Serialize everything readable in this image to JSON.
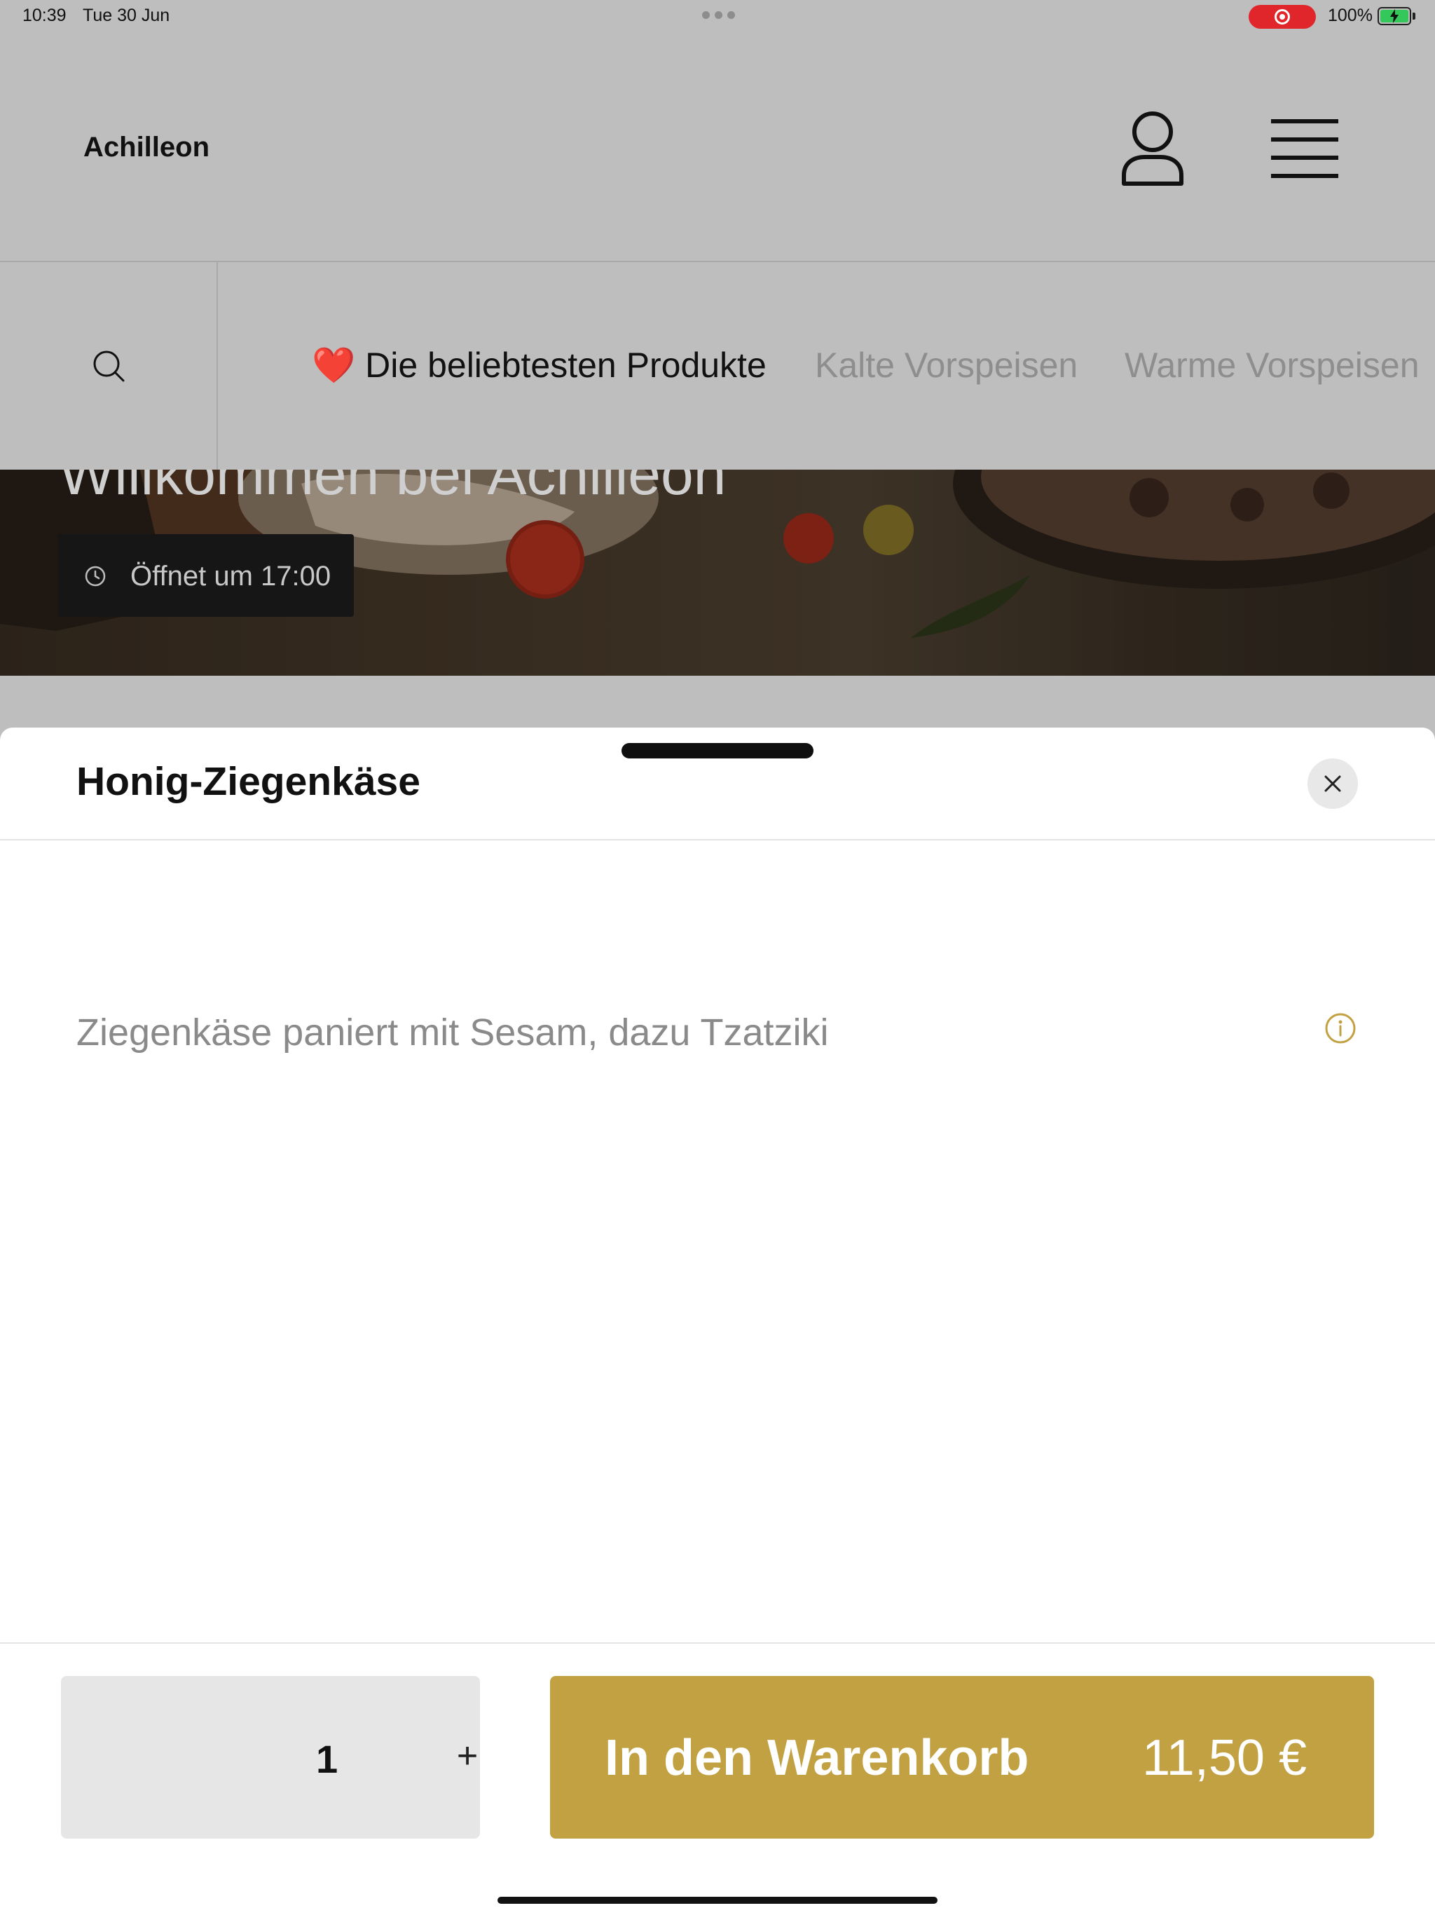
{
  "status_bar": {
    "time": "10:39",
    "date": "Tue 30 Jun",
    "battery_percent": "100%",
    "recording": true
  },
  "header": {
    "brand": "Achilleon",
    "icons": [
      "user-icon",
      "hamburger-menu-icon"
    ]
  },
  "category_bar": {
    "search_icon": "search-icon",
    "tabs": [
      {
        "emoji": "❤️",
        "label": "Die beliebtesten Produkte",
        "active": true
      },
      {
        "label": "Kalte Vorspeisen",
        "active": false
      },
      {
        "label": "Warme Vorspeisen",
        "active": false
      }
    ]
  },
  "hero": {
    "welcome": "Willkommen bei Achilleon",
    "opening_hours": "Öffnet um 17:00"
  },
  "product_sheet": {
    "title": "Honig-Ziegenkäse",
    "description": "Ziegenkäse paniert mit Sesam, dazu Tzatziki",
    "quantity": "1",
    "plus_label": "+",
    "add_to_cart_label": "In den Warenkorb",
    "price": "11,50 €"
  },
  "colors": {
    "accent": "#c2a142",
    "overlay_background": "#bebebe",
    "recording": "#e0262a",
    "battery": "#34c759"
  }
}
